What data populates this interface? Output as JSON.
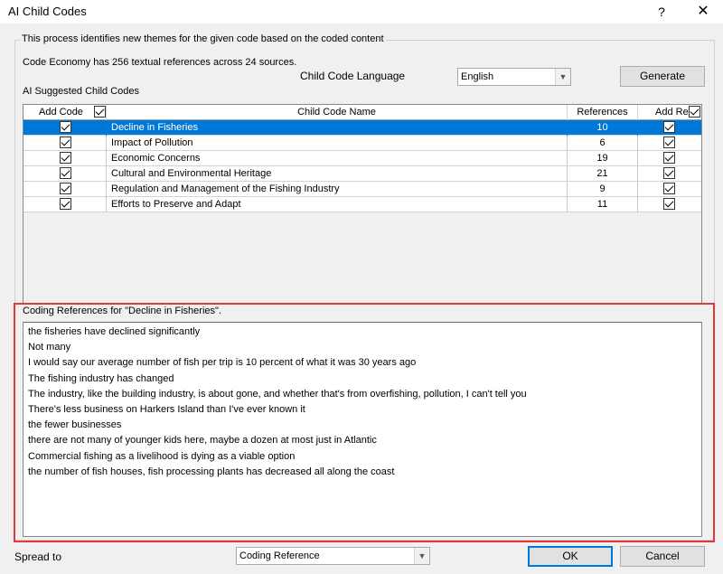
{
  "window": {
    "title": "AI Child Codes",
    "help_label": "?",
    "close_label": "✕"
  },
  "intro": {
    "legend": "This process identifies new themes for the given code based on the coded content",
    "summary": "Code Economy has 256 textual references across 24 sources.",
    "language_label": "Child Code Language",
    "language_value": "English",
    "generate_label": "Generate",
    "suggested_label": "AI Suggested Child Codes"
  },
  "grid": {
    "headers": {
      "add_code": "Add Code",
      "name": "Child Code Name",
      "references": "References",
      "add_refs": "Add Refs"
    },
    "rows": [
      {
        "name": "Decline in Fisheries",
        "references": "10",
        "add_code": true,
        "add_refs": true,
        "selected": true
      },
      {
        "name": "Impact of Pollution",
        "references": "6",
        "add_code": true,
        "add_refs": true,
        "selected": false
      },
      {
        "name": "Economic Concerns",
        "references": "19",
        "add_code": true,
        "add_refs": true,
        "selected": false
      },
      {
        "name": "Cultural and Environmental Heritage",
        "references": "21",
        "add_code": true,
        "add_refs": true,
        "selected": false
      },
      {
        "name": "Regulation and Management of the Fishing Industry",
        "references": "9",
        "add_code": true,
        "add_refs": true,
        "selected": false
      },
      {
        "name": "Efforts to Preserve and Adapt",
        "references": "11",
        "add_code": true,
        "add_refs": true,
        "selected": false
      }
    ]
  },
  "coding_refs": {
    "label": "Coding References for \"Decline in Fisheries\".",
    "lines": [
      "the fisheries have declined significantly",
      "Not many",
      "I would say our average number of fish per trip is 10 percent of what it was 30 years ago",
      "The fishing industry has changed",
      "The industry, like the building industry, is about gone, and whether that's from overfishing, pollution, I can't tell you",
      "There's less business on Harkers Island than I've ever known it",
      "the fewer businesses",
      "there are not many of younger kids here, maybe a dozen at most just in Atlantic",
      "Commercial fishing as a livelihood is dying as a viable option",
      "the number of fish houses, fish processing plants has decreased all along the coast"
    ]
  },
  "footer": {
    "spread_label": "Spread to",
    "spread_value": "Coding Reference",
    "ok_label": "OK",
    "cancel_label": "Cancel"
  },
  "colors": {
    "selection": "#0078d7",
    "highlight_border": "#e8353a"
  }
}
